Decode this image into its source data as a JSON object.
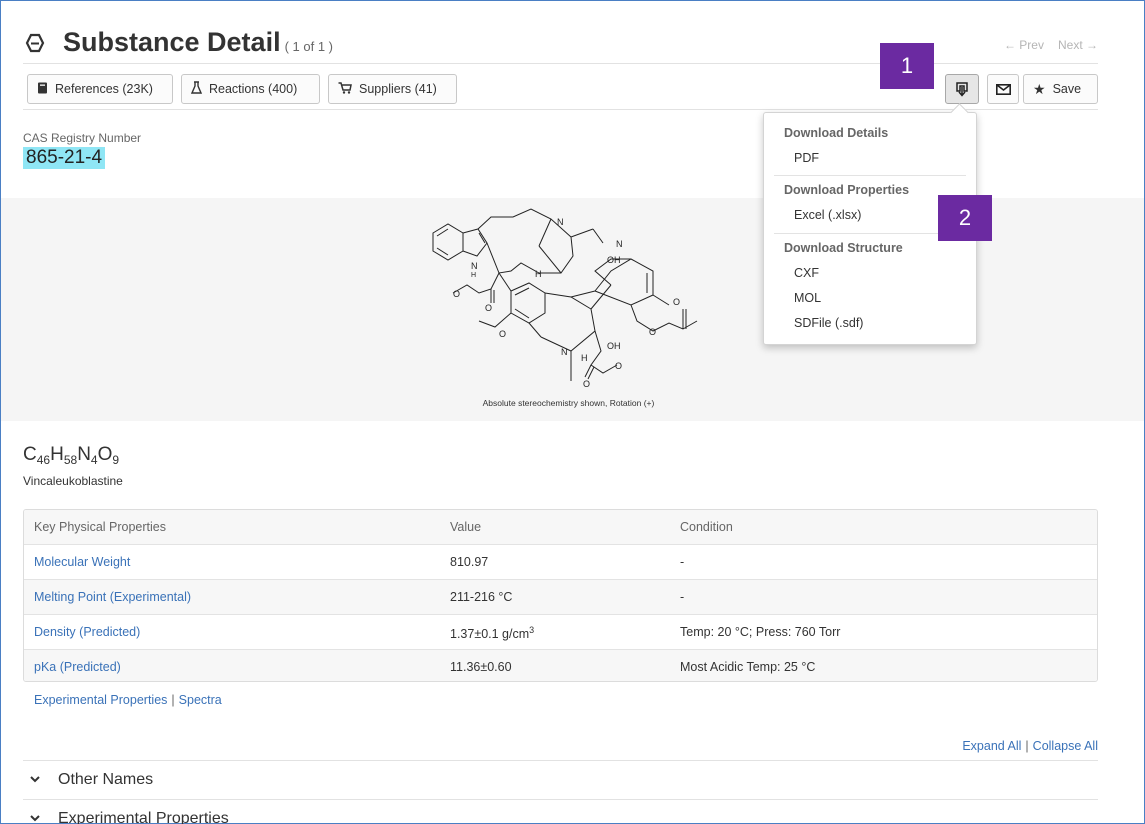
{
  "header": {
    "title": "Substance Detail",
    "count": "( 1 of 1 )",
    "prev": "← Prev",
    "next": "Next →"
  },
  "toolbar": {
    "references": "References (23K)",
    "reactions": "Reactions (400)",
    "suppliers": "Suppliers (41)",
    "save": "Save",
    "icons": [
      "book-icon",
      "flask-icon",
      "cart-icon",
      "download-icon",
      "envelope-icon",
      "star-icon"
    ]
  },
  "callouts": [
    "1",
    "2"
  ],
  "substance": {
    "cas_label": "CAS Registry Number",
    "cas_number": "865-21-4",
    "structure_caption": "Absolute stereochemistry shown, Rotation (+)",
    "formula": [
      {
        "t": "C"
      },
      {
        "s": "46"
      },
      {
        "t": "H"
      },
      {
        "s": "58"
      },
      {
        "t": "N"
      },
      {
        "s": "4"
      },
      {
        "t": "O"
      },
      {
        "s": "9"
      }
    ],
    "name": "Vincaleukoblastine"
  },
  "download_menu": {
    "sections": [
      {
        "heading": "Download Details",
        "items": [
          "PDF"
        ]
      },
      {
        "heading": "Download Properties",
        "items": [
          "Excel (.xlsx)"
        ]
      },
      {
        "heading": "Download Structure",
        "items": [
          "CXF",
          "MOL",
          "SDFile (.sdf)"
        ]
      }
    ]
  },
  "properties": {
    "columns": [
      "Key Physical Properties",
      "Value",
      "Condition"
    ],
    "rows": [
      {
        "property": "Molecular Weight",
        "value": "810.97",
        "condition": "-"
      },
      {
        "property": "Melting Point (Experimental)",
        "value": "211-216 °C",
        "condition": "-"
      },
      {
        "property": "Density (Predicted)",
        "value": "1.37±0.1 g/cm",
        "value_sup": "3",
        "condition": "Temp: 20 °C; Press: 760 Torr"
      },
      {
        "property": "pKa (Predicted)",
        "value": "11.36±0.60",
        "condition": "Most Acidic Temp: 25 °C"
      }
    ]
  },
  "links": {
    "experimental": "Experimental Properties",
    "separator": "|",
    "spectra": "Spectra",
    "expand_all": "Expand All",
    "collapse_all": "Collapse All"
  },
  "sections": [
    "Other Names",
    "Experimental Properties"
  ]
}
